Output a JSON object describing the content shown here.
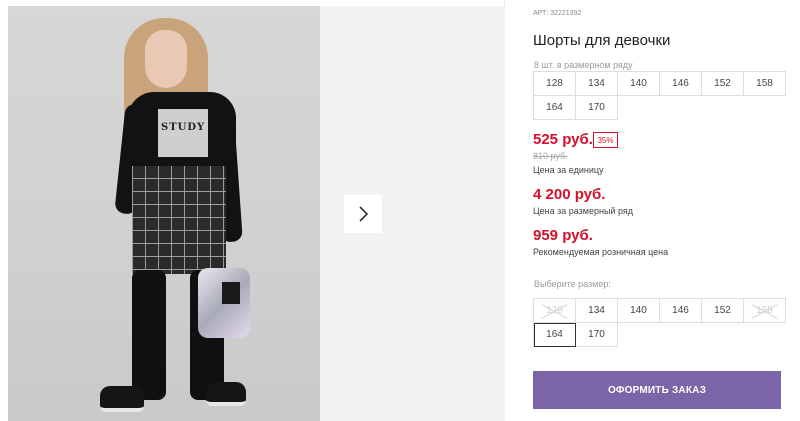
{
  "product": {
    "sku": "АРТ: 32221392",
    "title": "Шорты для девочки",
    "image_print_text": "STUDY"
  },
  "size_range": {
    "note": "8 шт. в размерном ряду",
    "sizes": [
      "128",
      "134",
      "140",
      "146",
      "152",
      "158",
      "164",
      "170"
    ]
  },
  "pricing": {
    "unit_price": "525 руб.",
    "discount": "35%",
    "old_price": "810 руб.",
    "unit_label": "Цена за единицу",
    "range_price": "4 200 руб.",
    "range_label": "Цена за размерный ряд",
    "rrp_price": "959 руб.",
    "rrp_label": "Рекомендуемая розничная цена"
  },
  "size_select": {
    "label": "Выберите размер:",
    "options": [
      {
        "size": "128",
        "available": false
      },
      {
        "size": "134",
        "available": true
      },
      {
        "size": "140",
        "available": true
      },
      {
        "size": "146",
        "available": true
      },
      {
        "size": "152",
        "available": true
      },
      {
        "size": "158",
        "available": false
      },
      {
        "size": "164",
        "available": true,
        "selected": true
      },
      {
        "size": "170",
        "available": true
      }
    ]
  },
  "actions": {
    "order_label": "ОФОРМИТЬ ЗАКАЗ"
  },
  "gallery": {
    "next_icon": "chevron-right-icon"
  },
  "colors": {
    "price_red": "#d4102a",
    "button_purple": "#7b64a8"
  }
}
